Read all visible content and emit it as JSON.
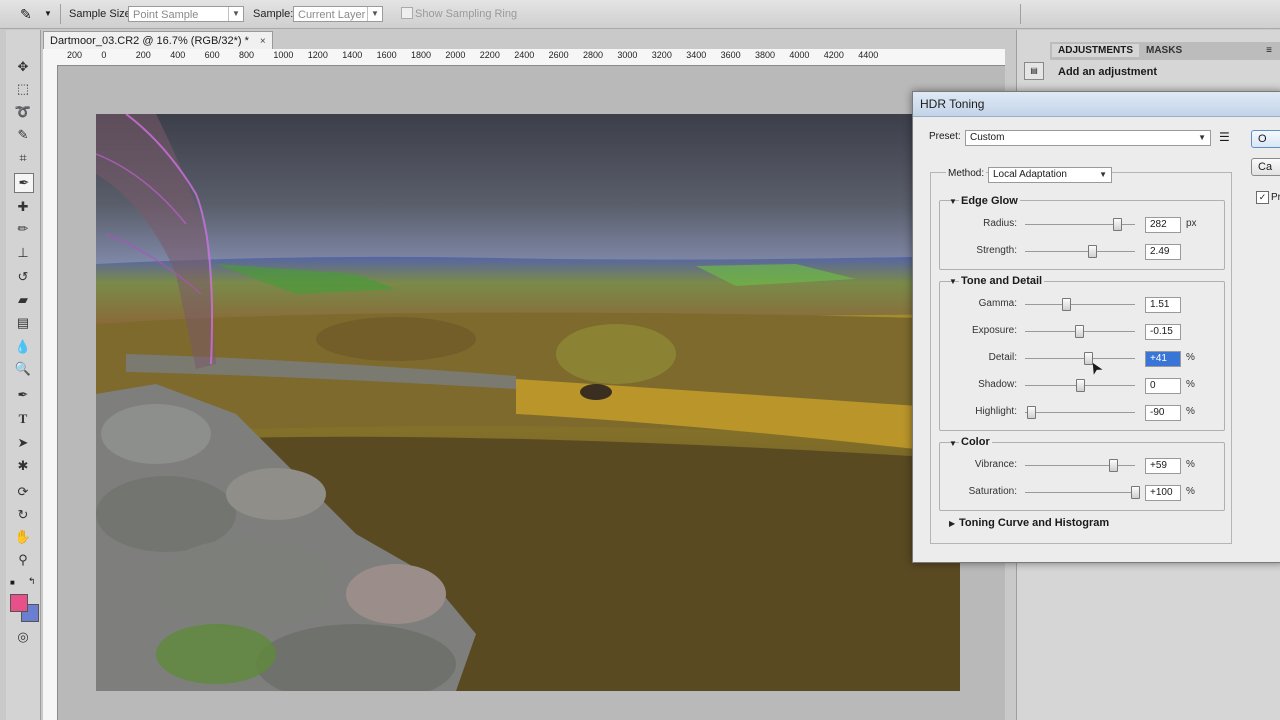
{
  "options_bar": {
    "sample_size_label": "Sample Size:",
    "sample_size_value": "Point Sample",
    "sample_label": "Sample:",
    "sample_value": "Current Layer",
    "show_sampling_ring_label": "Show Sampling Ring"
  },
  "document": {
    "tab_title": "Dartmoor_03.CR2 @ 16.7% (RGB/32*) *",
    "close_symbol": "×",
    "ruler_ticks": [
      "200",
      "0",
      "200",
      "400",
      "600",
      "800",
      "1000",
      "1200",
      "1400",
      "1600",
      "1800",
      "2000",
      "2200",
      "2400",
      "2600",
      "2800",
      "3000",
      "3200",
      "3400",
      "3600",
      "3800",
      "4000",
      "4200",
      "4400"
    ]
  },
  "panels": {
    "tabs": [
      "ADJUSTMENTS",
      "MASKS"
    ],
    "heading": "Add an adjustment"
  },
  "hdr_dialog": {
    "title": "HDR Toning",
    "preset_label": "Preset:",
    "preset_value": "Custom",
    "method_label": "Method:",
    "method_value": "Local Adaptation",
    "ok_button": "O",
    "cancel_button": "Ca",
    "preview_label": "Pr",
    "preview_checked": true,
    "edge_glow": {
      "title": "Edge Glow",
      "radius": {
        "label": "Radius:",
        "value": "282",
        "unit": "px",
        "position": 0.84
      },
      "strength": {
        "label": "Strength:",
        "value": "2.49",
        "unit": "",
        "position": 0.61
      }
    },
    "tone_detail": {
      "title": "Tone and Detail",
      "gamma": {
        "label": "Gamma:",
        "value": "1.51",
        "unit": "",
        "position": 0.37
      },
      "exposure": {
        "label": "Exposure:",
        "value": "-0.15",
        "unit": "",
        "position": 0.49
      },
      "detail": {
        "label": "Detail:",
        "value": "+41",
        "unit": "%",
        "position": 0.57
      },
      "shadow": {
        "label": "Shadow:",
        "value": "0",
        "unit": "%",
        "position": 0.5
      },
      "highlight": {
        "label": "Highlight:",
        "value": "-90",
        "unit": "%",
        "position": 0.05
      }
    },
    "color": {
      "title": "Color",
      "vibrance": {
        "label": "Vibrance:",
        "value": "+59",
        "unit": "%",
        "position": 0.8
      },
      "saturation": {
        "label": "Saturation:",
        "value": "+100",
        "unit": "%",
        "position": 1.0
      }
    },
    "toning_curve_title": "Toning Curve and Histogram"
  },
  "colors": {
    "foreground": "#e8508a",
    "background": "#6a7fd0",
    "highlight_field": "#3875d7"
  }
}
